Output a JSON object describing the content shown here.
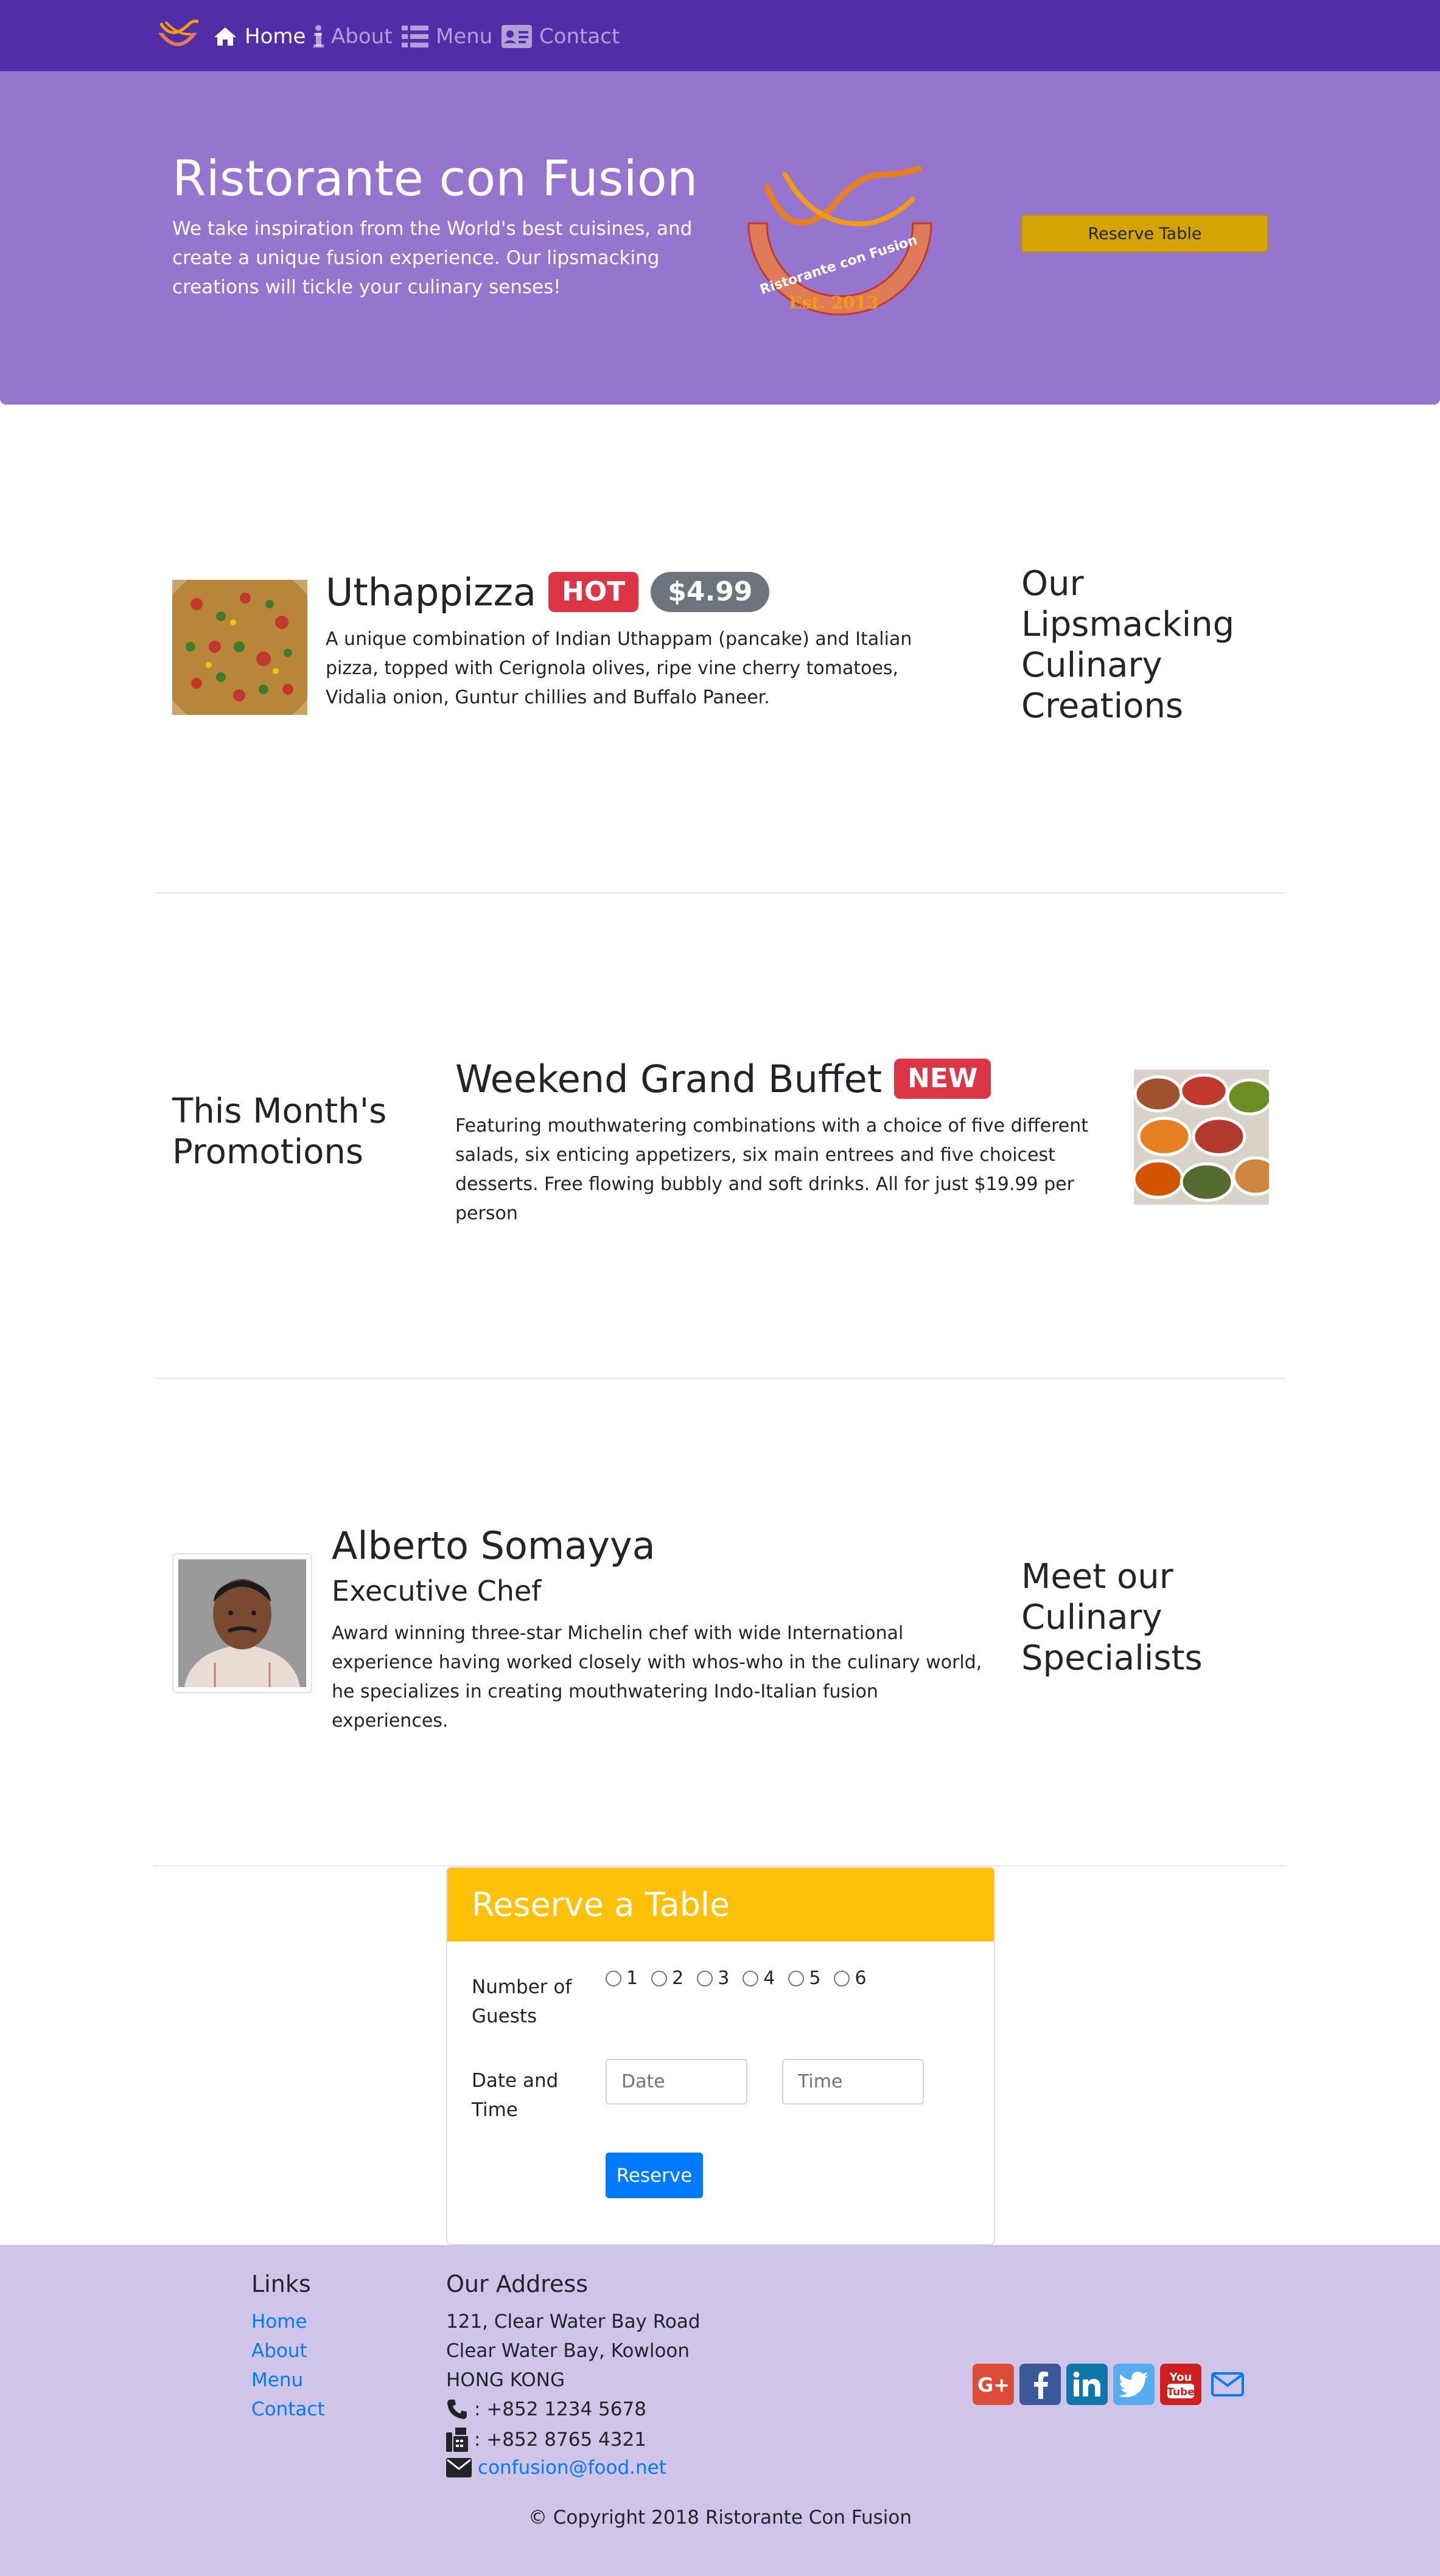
{
  "nav": {
    "items": [
      {
        "label": "Home",
        "icon": "home-icon"
      },
      {
        "label": "About",
        "icon": "info-icon"
      },
      {
        "label": "Menu",
        "icon": "list-icon"
      },
      {
        "label": "Contact",
        "icon": "address-card-icon"
      }
    ]
  },
  "jumbotron": {
    "title": "Ristorante con Fusion",
    "text": "We take inspiration from the World's best cuisines, and create a unique fusion experience. Our lipsmacking creations will tickle your culinary senses!",
    "logo_text": "Ristorante con Fusion",
    "logo_est": "Est. 2013",
    "reserve_label": "Reserve Table"
  },
  "dish": {
    "name": "Uthappizza",
    "badge": "HOT",
    "price": "$4.99",
    "description": "A unique combination of Indian Uthappam (pancake) and Italian pizza, topped with Cerignola olives, ripe vine cherry tomatoes, Vidalia onion, Guntur chillies and Buffalo Paneer.",
    "section_title": "Our Lipsmacking Culinary Creations"
  },
  "promotion": {
    "section_title": "This Month's Promotions",
    "name": "Weekend Grand Buffet",
    "badge": "NEW",
    "description": "Featuring mouthwatering combinations with a choice of five different salads, six enticing appetizers, six main entrees and five choicest desserts. Free flowing bubbly and soft drinks. All for just $19.99 per person"
  },
  "leader": {
    "name": "Alberto Somayya",
    "designation": "Executive Chef",
    "description": "Award winning three-star Michelin chef with wide International experience having worked closely with whos-who in the culinary world, he specializes in creating mouthwatering Indo-Italian fusion experiences.",
    "section_title": "Meet our Culinary Specialists"
  },
  "reserve_form": {
    "title": "Reserve a Table",
    "guests_label": "Number of Guests",
    "guest_options": [
      "1",
      "2",
      "3",
      "4",
      "5",
      "6"
    ],
    "datetime_label": "Date and Time",
    "date_placeholder": "Date",
    "time_placeholder": "Time",
    "submit_label": "Reserve"
  },
  "footer": {
    "links_heading": "Links",
    "links": [
      "Home",
      "About",
      "Menu",
      "Contact"
    ],
    "address_heading": "Our Address",
    "address_lines": [
      "121, Clear Water Bay Road",
      "Clear Water Bay, Kowloon",
      "HONG KONG"
    ],
    "phone": ": +852 1234 5678",
    "fax": ": +852 8765 4321",
    "email": "confusion@food.net",
    "social": [
      "google-plus-icon",
      "facebook-icon",
      "linkedin-icon",
      "twitter-icon",
      "youtube-icon",
      "mail-icon"
    ],
    "copyright": "© Copyright 2018 Ristorante Con Fusion"
  },
  "colors": {
    "navbar": "#512da8",
    "jumbotron": "#9575cd",
    "footer": "#d1c4e9",
    "accent": "#ffc107",
    "danger": "#dc3545",
    "primary": "#007bff"
  }
}
